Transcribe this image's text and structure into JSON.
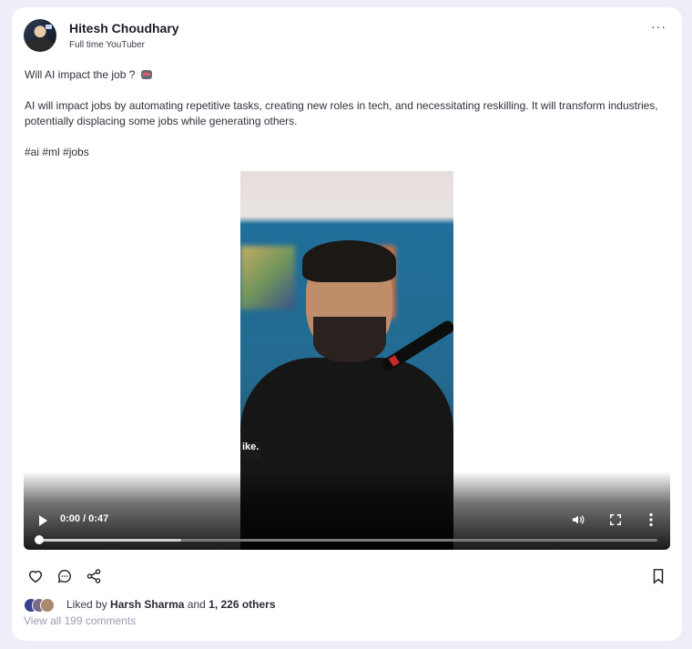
{
  "author": {
    "name": "Hitesh Choudhary",
    "role": "Full time YouTuber"
  },
  "post": {
    "title": "Will AI impact the job ?",
    "title_icon": "robot-icon",
    "body": "AI will impact jobs by automating repetitive tasks, creating new roles in tech, and necessitating reskilling. It will transform industries, potentially displacing some jobs while generating others.",
    "hashtags": "#ai #ml #jobs"
  },
  "video": {
    "caption_fragment": "ike.",
    "time": "0:00 / 0:47",
    "buffered_fraction": 0.23,
    "played_fraction": 0.0
  },
  "likes": {
    "prefix": "Liked by",
    "user": "Harsh Sharma",
    "joiner": "and",
    "others": "1, 226 others"
  },
  "comments_link": "View all 199 comments",
  "colors": {
    "page_bg": "#efedf8",
    "card_bg": "#ffffff",
    "muted_text": "#9b9bb0"
  }
}
